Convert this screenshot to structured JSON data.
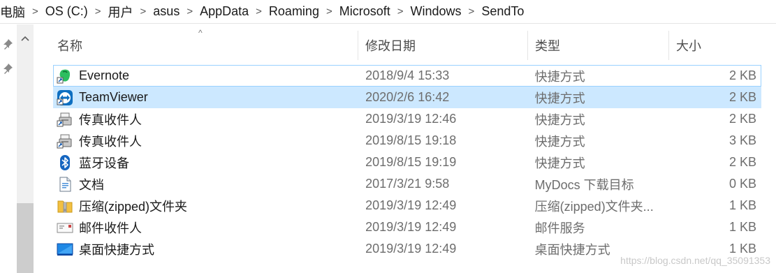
{
  "breadcrumb": {
    "items": [
      "电脑",
      "OS (C:)",
      "用户",
      "asus",
      "AppData",
      "Roaming",
      "Microsoft",
      "Windows",
      "SendTo"
    ],
    "separator": ">"
  },
  "columns": {
    "name": "名称",
    "date": "修改日期",
    "type": "类型",
    "size": "大小"
  },
  "files": [
    {
      "name": "Evernote",
      "date": "2018/9/4 15:33",
      "type": "快捷方式",
      "size": "2 KB",
      "icon": "evernote-shortcut-icon"
    },
    {
      "name": "TeamViewer",
      "date": "2020/2/6 16:42",
      "type": "快捷方式",
      "size": "2 KB",
      "icon": "teamviewer-shortcut-icon"
    },
    {
      "name": "传真收件人",
      "date": "2019/3/19 12:46",
      "type": "快捷方式",
      "size": "2 KB",
      "icon": "fax-shortcut-icon"
    },
    {
      "name": "传真收件人",
      "date": "2019/8/15 19:18",
      "type": "快捷方式",
      "size": "3 KB",
      "icon": "fax-shortcut-icon"
    },
    {
      "name": "蓝牙设备",
      "date": "2019/8/15 19:19",
      "type": "快捷方式",
      "size": "2 KB",
      "icon": "bluetooth-shortcut-icon"
    },
    {
      "name": "文档",
      "date": "2017/3/21 9:58",
      "type": "MyDocs 下载目标",
      "size": "0 KB",
      "icon": "documents-icon"
    },
    {
      "name": "压缩(zipped)文件夹",
      "date": "2019/3/19 12:49",
      "type": "压缩(zipped)文件夹...",
      "size": "1 KB",
      "icon": "zip-folder-icon"
    },
    {
      "name": "邮件收件人",
      "date": "2019/3/19 12:49",
      "type": "邮件服务",
      "size": "1 KB",
      "icon": "mail-recipient-icon"
    },
    {
      "name": "桌面快捷方式",
      "date": "2019/3/19 12:49",
      "type": "桌面快捷方式",
      "size": "1 KB",
      "icon": "desktop-shortcut-icon"
    }
  ],
  "watermark": "https://blog.csdn.net/qq_35091353",
  "colors": {
    "selected_row": "#cce8ff",
    "focus_border": "#99d1ff",
    "muted_text": "#6d6d6d"
  }
}
